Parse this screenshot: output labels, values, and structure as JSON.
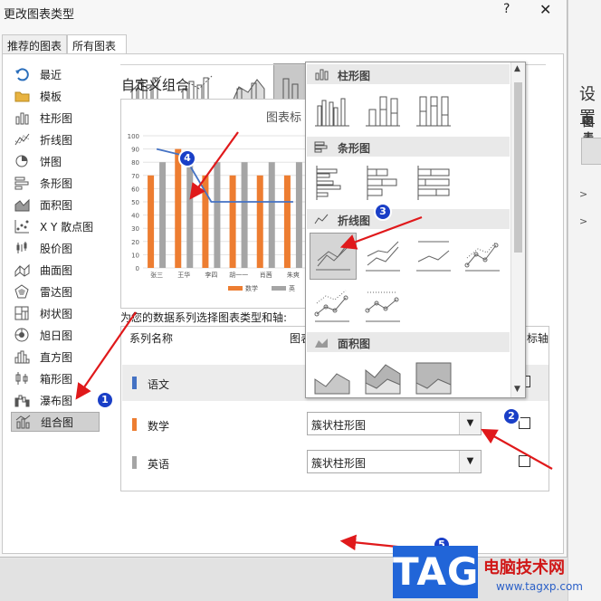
{
  "dialog": {
    "title": "更改图表类型",
    "help": "?",
    "close": "✕",
    "tabs": [
      {
        "label": "推荐的图表"
      },
      {
        "label": "所有图表"
      }
    ],
    "categories": [
      {
        "label": "最近",
        "icon": "recent-icon"
      },
      {
        "label": "模板",
        "icon": "folder-icon"
      },
      {
        "label": "柱形图",
        "icon": "column-chart-icon"
      },
      {
        "label": "折线图",
        "icon": "line-chart-icon"
      },
      {
        "label": "饼图",
        "icon": "pie-chart-icon"
      },
      {
        "label": "条形图",
        "icon": "bar-chart-icon"
      },
      {
        "label": "面积图",
        "icon": "area-chart-icon"
      },
      {
        "label": "X Y 散点图",
        "icon": "scatter-chart-icon"
      },
      {
        "label": "股价图",
        "icon": "stock-chart-icon"
      },
      {
        "label": "曲面图",
        "icon": "surface-chart-icon"
      },
      {
        "label": "雷达图",
        "icon": "radar-chart-icon"
      },
      {
        "label": "树状图",
        "icon": "treemap-icon"
      },
      {
        "label": "旭日图",
        "icon": "sunburst-icon"
      },
      {
        "label": "直方图",
        "icon": "histogram-icon"
      },
      {
        "label": "箱形图",
        "icon": "box-whisker-icon"
      },
      {
        "label": "瀑布图",
        "icon": "waterfall-icon"
      },
      {
        "label": "组合图",
        "icon": "combo-chart-icon"
      }
    ],
    "custom_combo_title": "自定义组合",
    "preview_title": "图表标",
    "series_prompt": "为您的数据系列选择图表类型和轴:",
    "table_headers": {
      "name": "系列名称",
      "type": "图表",
      "axis": "标轴"
    },
    "series": [
      {
        "name": "语文",
        "type": "折线图",
        "color": "#4472c4"
      },
      {
        "name": "数学",
        "type": "簇状柱形图",
        "color": "#ed7d31"
      },
      {
        "name": "英语",
        "type": "簇状柱形图",
        "color": "#a5a5a5"
      }
    ]
  },
  "gallery": {
    "sections": [
      {
        "label": "柱形图"
      },
      {
        "label": "条形图"
      },
      {
        "label": "折线图"
      },
      {
        "label": "面积图"
      }
    ]
  },
  "annotations": {
    "badges": [
      "1",
      "2",
      "3",
      "4",
      "5"
    ]
  },
  "watermark": {
    "tag": "TAG",
    "site_name": "电脑技术网",
    "url": "www.tagxp.com"
  },
  "background_window": {
    "title": "设置",
    "subtitle": "图表"
  },
  "chart_data": {
    "type": "bar",
    "title": "图表标",
    "categories": [
      "张三",
      "王华",
      "李四",
      "胡一一",
      "肖茜",
      "朱爽"
    ],
    "ylim": [
      0,
      100
    ],
    "yticks": [
      "0",
      "10",
      "20",
      "30",
      "40",
      "50",
      "60",
      "70",
      "80",
      "90",
      "100"
    ],
    "series": [
      {
        "name": "数学",
        "kind": "bar",
        "color": "#ed7d31",
        "values": [
          70,
          90,
          70,
          70,
          70,
          70
        ]
      },
      {
        "name": "英",
        "kind": "bar",
        "color": "#a5a5a5",
        "values": [
          80,
          80,
          80,
          80,
          80,
          80
        ]
      },
      {
        "name": "语文",
        "kind": "line",
        "color": "#4472c4",
        "values": [
          90,
          85,
          50,
          50,
          50,
          50
        ]
      }
    ]
  }
}
